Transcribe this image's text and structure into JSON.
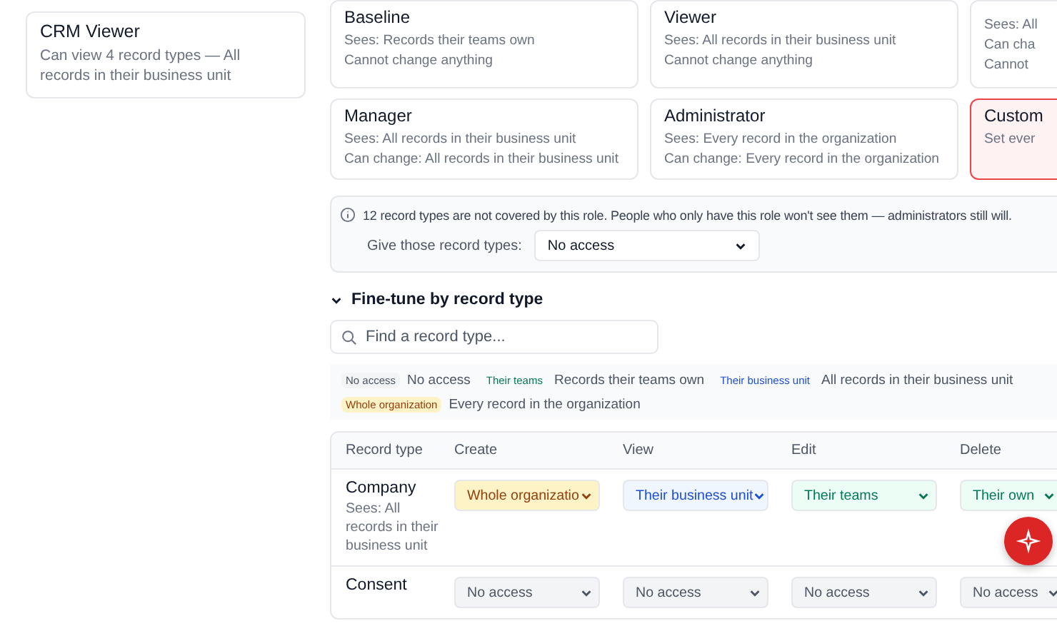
{
  "sidebar": {
    "roles": [
      {
        "name": "CRM Viewer",
        "description": "Can view 4 record types — All records in their business unit",
        "selected": false
      }
    ]
  },
  "presets": [
    {
      "title": "Baseline",
      "lines": [
        "Sees: Records their teams own",
        "Cannot change anything"
      ],
      "selected": false
    },
    {
      "title": "Viewer",
      "lines": [
        "Sees: All records in their business unit",
        "Cannot change anything"
      ],
      "selected": false
    },
    {
      "lines": [
        "Sees: All",
        "Can cha",
        "Cannot"
      ],
      "selected": false
    },
    {
      "title": "Manager",
      "lines": [
        "Sees: All records in their business unit",
        "Can change: All records in their business unit"
      ],
      "selected": false
    },
    {
      "title": "Administrator",
      "lines": [
        "Sees: Every record in the organization",
        "Can change: Every record in the organization"
      ],
      "selected": false
    },
    {
      "title": "Custom",
      "lines": [
        "Set ever"
      ],
      "selected": true
    }
  ],
  "notice": {
    "text": "12 record types are not covered by this role. People who only have this role won't see them — administrators still will.",
    "field_label": "Give those record types:",
    "field_value": "No access"
  },
  "fine_tune": {
    "title": "Fine-tune by record type",
    "expanded": true,
    "search": {
      "placeholder": "Find a record type..."
    },
    "legend": [
      {
        "kind": "none",
        "badge": "No access",
        "description": "No access"
      },
      {
        "kind": "teams",
        "badge": "Their teams",
        "description": "Records their teams own"
      },
      {
        "kind": "unit",
        "badge": "Their business unit",
        "description": "All records in their business unit"
      },
      {
        "kind": "org",
        "badge": "Whole organization",
        "description": "Every record in the organization"
      }
    ],
    "table": {
      "record_column": "Record type",
      "columns": [
        "Create",
        "View",
        "Edit",
        "Delete"
      ],
      "rows": [
        {
          "name": "Company",
          "summary": "Sees: All records in their business unit",
          "cells": [
            {
              "kind": "org",
              "value": "Whole organizatio"
            },
            {
              "kind": "unit",
              "value": "Their business unit"
            },
            {
              "kind": "teams",
              "value": "Their teams"
            },
            {
              "kind": "teams",
              "value": "Their own"
            }
          ]
        },
        {
          "name": "Consent",
          "cells": [
            {
              "kind": "none",
              "value": "No access"
            },
            {
              "kind": "none",
              "value": "No access"
            },
            {
              "kind": "none",
              "value": "No access"
            },
            {
              "kind": "none",
              "value": "No access"
            }
          ]
        }
      ]
    }
  }
}
